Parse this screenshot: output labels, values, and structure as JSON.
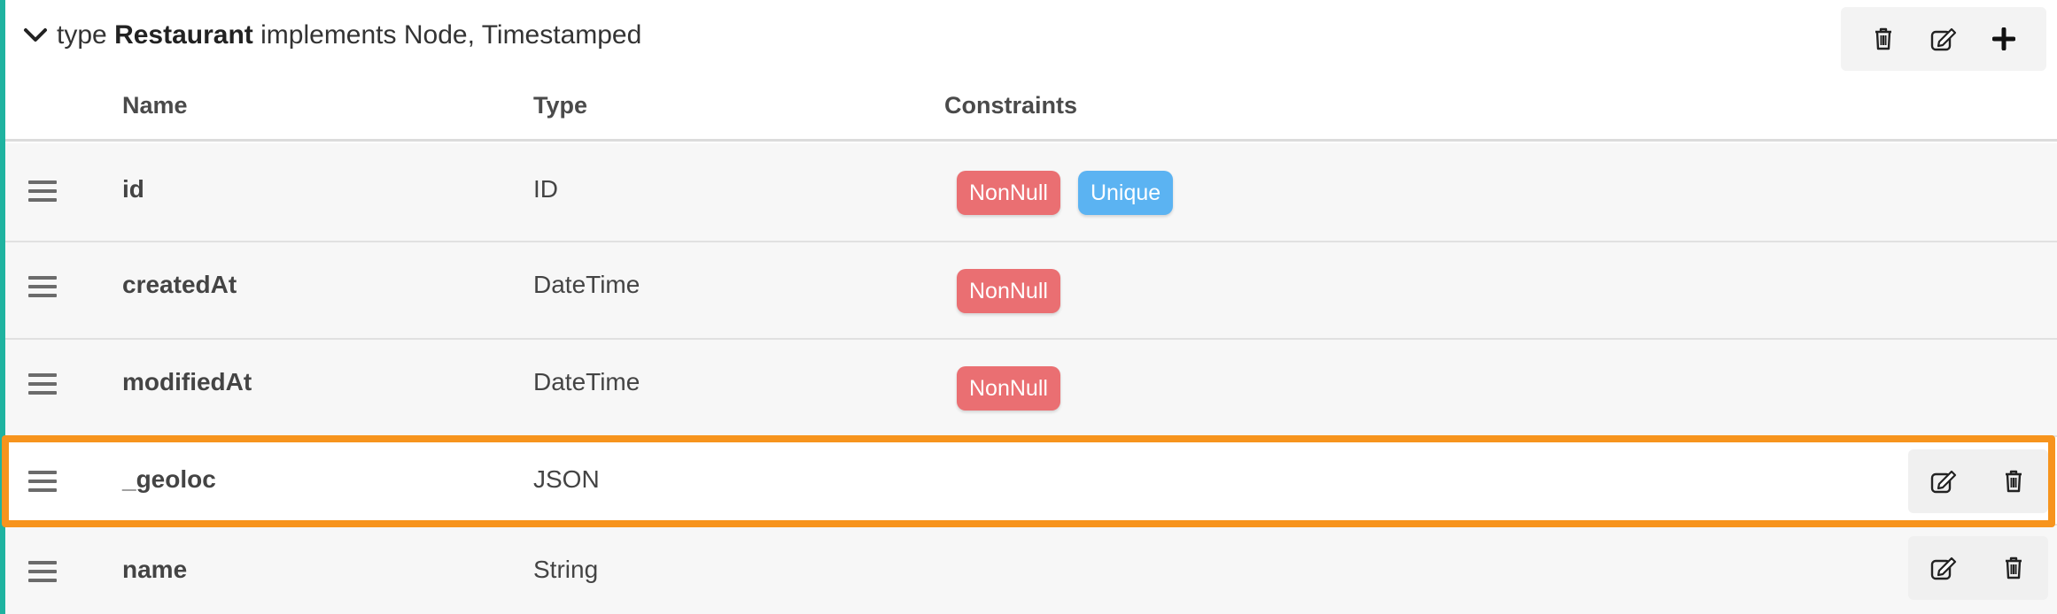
{
  "type_header": {
    "keyword": "type",
    "name": "Restaurant",
    "implements_text": "implements Node, Timestamped",
    "actions": {
      "delete_icon": "trash-icon",
      "edit_icon": "edit-icon",
      "add_icon": "plus-icon"
    }
  },
  "columns": {
    "name": "Name",
    "type": "Type",
    "constraints": "Constraints"
  },
  "fields": [
    {
      "name": "id",
      "type": "ID",
      "constraints": [
        "NonNull",
        "Unique"
      ],
      "highlighted": false,
      "has_actions": false
    },
    {
      "name": "createdAt",
      "type": "DateTime",
      "constraints": [
        "NonNull"
      ],
      "highlighted": false,
      "has_actions": false
    },
    {
      "name": "modifiedAt",
      "type": "DateTime",
      "constraints": [
        "NonNull"
      ],
      "highlighted": false,
      "has_actions": false
    },
    {
      "name": "_geoloc",
      "type": "JSON",
      "constraints": [],
      "highlighted": true,
      "has_actions": true
    },
    {
      "name": "name",
      "type": "String",
      "constraints": [],
      "highlighted": false,
      "has_actions": true
    }
  ],
  "colors": {
    "accent_left": "#1fb3a0",
    "highlight": "#f7941d",
    "nonnull_badge": "#ea6f72",
    "unique_badge": "#5bb3f2"
  }
}
